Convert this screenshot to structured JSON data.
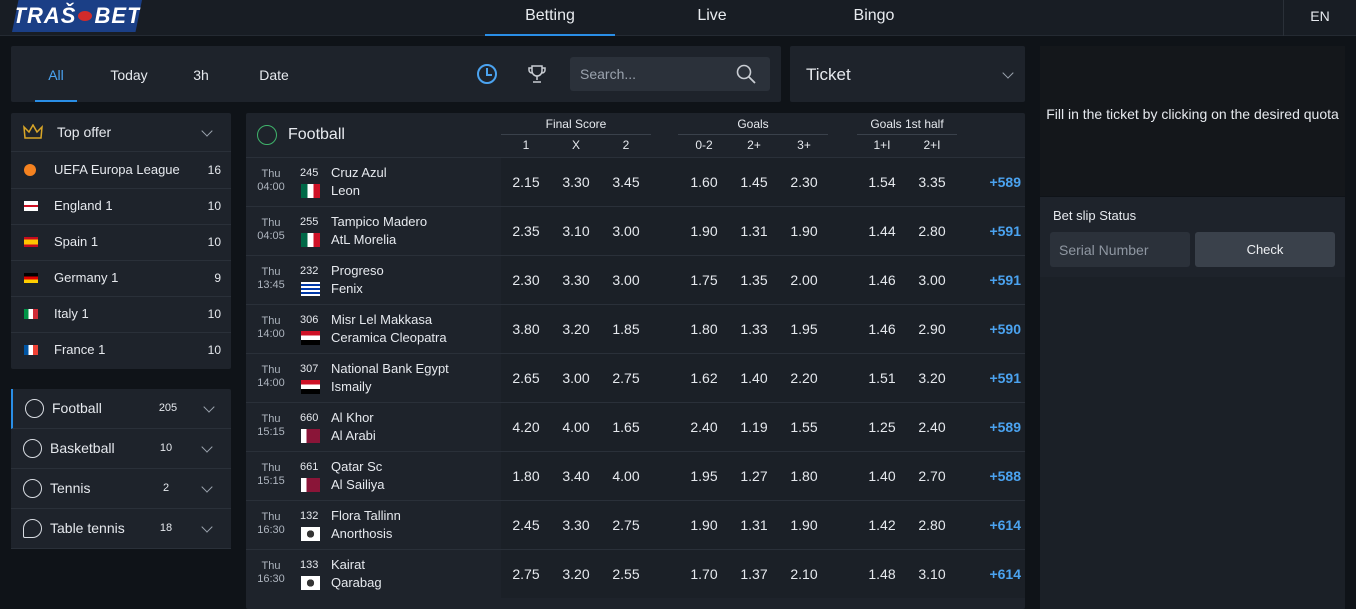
{
  "header": {
    "logo": "TRAŠ BET",
    "tabs": [
      "Betting",
      "Live",
      "Bingo"
    ],
    "lang": "EN"
  },
  "filters": {
    "tabs": [
      "All",
      "Today",
      "3h",
      "Date"
    ],
    "search_placeholder": "Search..."
  },
  "ticket": {
    "label": "Ticket",
    "message": "Fill in the ticket by clicking on the desired quota",
    "status_label": "Bet slip Status",
    "serial_placeholder": "Serial Number",
    "check_label": "Check"
  },
  "leagues": {
    "top_offer": "Top offer",
    "items": [
      {
        "name": "UEFA Europa League",
        "count": "16"
      },
      {
        "name": "England 1",
        "count": "10"
      },
      {
        "name": "Spain 1",
        "count": "10"
      },
      {
        "name": "Germany 1",
        "count": "9"
      },
      {
        "name": "Italy 1",
        "count": "10"
      },
      {
        "name": "France 1",
        "count": "10"
      }
    ]
  },
  "sports": [
    {
      "name": "Football",
      "count": "205"
    },
    {
      "name": "Basketball",
      "count": "10"
    },
    {
      "name": "Tennis",
      "count": "2"
    },
    {
      "name": "Table tennis",
      "count": "18"
    }
  ],
  "main": {
    "sport": "Football",
    "groups": [
      "Final Score",
      "Goals",
      "Goals 1st half"
    ],
    "cols": [
      "1",
      "X",
      "2",
      "0-2",
      "2+",
      "3+",
      "1+I",
      "2+I"
    ],
    "matches": [
      {
        "day": "Thu",
        "time": "04:00",
        "id": "245",
        "home": "Cruz Azul",
        "away": "Leon",
        "odds": [
          "2.15",
          "3.30",
          "3.45",
          "1.60",
          "1.45",
          "2.30",
          "1.54",
          "3.35"
        ],
        "more": "+589"
      },
      {
        "day": "Thu",
        "time": "04:05",
        "id": "255",
        "home": "Tampico Madero",
        "away": "AtL Morelia",
        "odds": [
          "2.35",
          "3.10",
          "3.00",
          "1.90",
          "1.31",
          "1.90",
          "1.44",
          "2.80"
        ],
        "more": "+591"
      },
      {
        "day": "Thu",
        "time": "13:45",
        "id": "232",
        "home": "Progreso",
        "away": "Fenix",
        "odds": [
          "2.30",
          "3.30",
          "3.00",
          "1.75",
          "1.35",
          "2.00",
          "1.46",
          "3.00"
        ],
        "more": "+591"
      },
      {
        "day": "Thu",
        "time": "14:00",
        "id": "306",
        "home": "Misr Lel Makkasa",
        "away": "Ceramica Cleopatra",
        "odds": [
          "3.80",
          "3.20",
          "1.85",
          "1.80",
          "1.33",
          "1.95",
          "1.46",
          "2.90"
        ],
        "more": "+590"
      },
      {
        "day": "Thu",
        "time": "14:00",
        "id": "307",
        "home": "National Bank Egypt",
        "away": "Ismaily",
        "odds": [
          "2.65",
          "3.00",
          "2.75",
          "1.62",
          "1.40",
          "2.20",
          "1.51",
          "3.20"
        ],
        "more": "+591"
      },
      {
        "day": "Thu",
        "time": "15:15",
        "id": "660",
        "home": "Al Khor",
        "away": "Al Arabi",
        "odds": [
          "4.20",
          "4.00",
          "1.65",
          "2.40",
          "1.19",
          "1.55",
          "1.25",
          "2.40"
        ],
        "more": "+589"
      },
      {
        "day": "Thu",
        "time": "15:15",
        "id": "661",
        "home": "Qatar Sc",
        "away": "Al Sailiya",
        "odds": [
          "1.80",
          "3.40",
          "4.00",
          "1.95",
          "1.27",
          "1.80",
          "1.40",
          "2.70"
        ],
        "more": "+588"
      },
      {
        "day": "Thu",
        "time": "16:30",
        "id": "132",
        "home": "Flora Tallinn",
        "away": "Anorthosis",
        "odds": [
          "2.45",
          "3.30",
          "2.75",
          "1.90",
          "1.31",
          "1.90",
          "1.42",
          "2.80"
        ],
        "more": "+614"
      },
      {
        "day": "Thu",
        "time": "16:30",
        "id": "133",
        "home": "Kairat",
        "away": "Qarabag",
        "odds": [
          "2.75",
          "3.20",
          "2.55",
          "1.70",
          "1.37",
          "2.10",
          "1.48",
          "3.10"
        ],
        "more": "+614"
      }
    ]
  }
}
